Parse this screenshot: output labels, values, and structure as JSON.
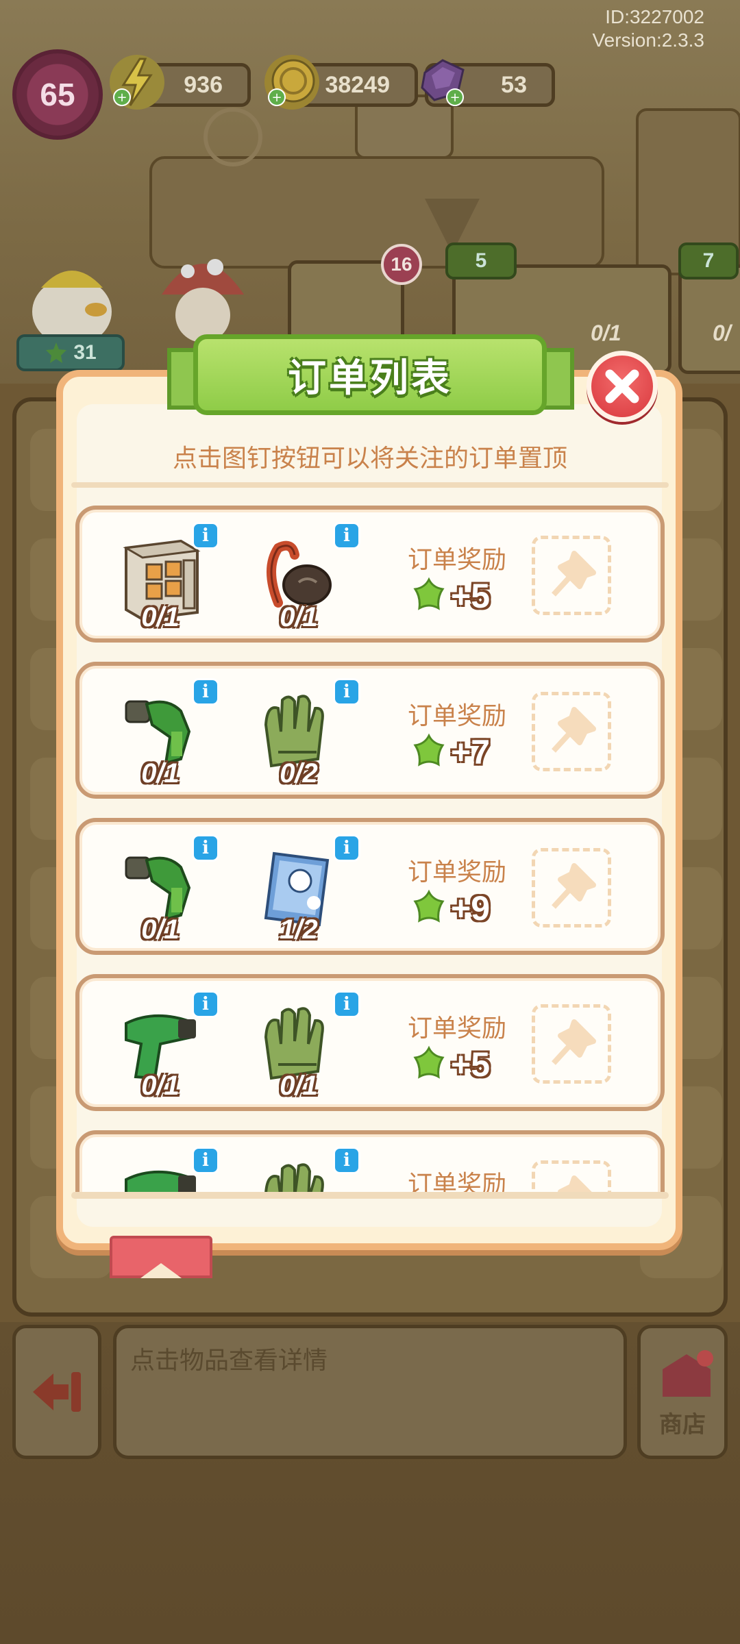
{
  "hud": {
    "id_text": "ID:3227002",
    "version_text": "Version:2.3.3",
    "level": "65",
    "energy": "936",
    "coins": "38249",
    "gems": "53"
  },
  "background": {
    "card_badge": "16",
    "star_badges": [
      "5",
      "7"
    ],
    "char_badge": "31",
    "item_counts": [
      "0/1",
      "0/"
    ]
  },
  "dialog": {
    "title": "订单列表",
    "hint": "点击图钉按钮可以将关注的订单置顶",
    "orders": [
      {
        "items": [
          {
            "name": "cabinet",
            "count": "0/1"
          },
          {
            "name": "slingshot",
            "count": "0/1"
          }
        ],
        "reward_label": "订单奖励",
        "reward": "+5"
      },
      {
        "items": [
          {
            "name": "drill",
            "count": "0/1"
          },
          {
            "name": "gloves",
            "count": "0/2"
          }
        ],
        "reward_label": "订单奖励",
        "reward": "+7"
      },
      {
        "items": [
          {
            "name": "drill",
            "count": "0/1"
          },
          {
            "name": "card",
            "count": "1/2"
          }
        ],
        "reward_label": "订单奖励",
        "reward": "+9"
      },
      {
        "items": [
          {
            "name": "drill",
            "count": "0/1"
          },
          {
            "name": "gloves",
            "count": "0/1"
          }
        ],
        "reward_label": "订单奖励",
        "reward": "+5"
      },
      {
        "items": [
          {
            "name": "drill",
            "count": ""
          },
          {
            "name": "gloves",
            "count": ""
          }
        ],
        "reward_label": "订单奖励",
        "reward": ""
      }
    ]
  },
  "bottom": {
    "info_text": "点击物品查看详情",
    "shop_label": "商店"
  },
  "colors": {
    "title_green": "#8fcc48",
    "close_red": "#d9383d",
    "reward_star": "#7fc73c",
    "info_blue": "#29a4e6",
    "label_orange": "#c9824b"
  }
}
